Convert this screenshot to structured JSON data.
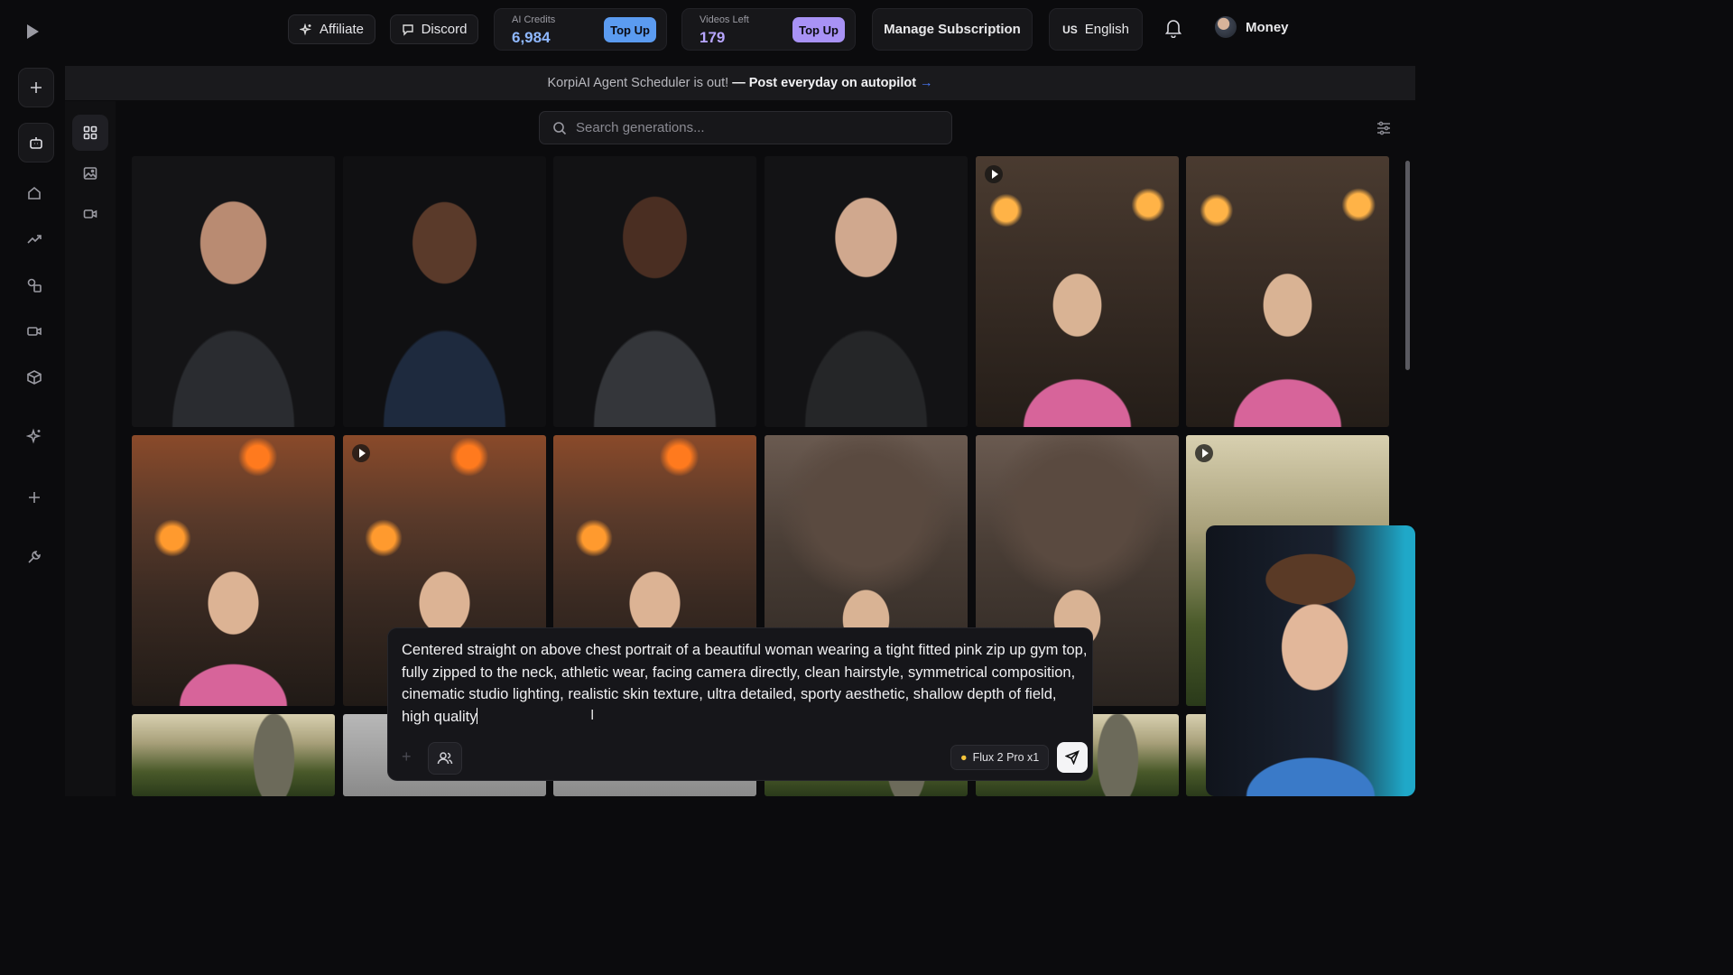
{
  "topbar": {
    "affiliate_label": "Affiliate",
    "discord_label": "Discord",
    "credits": {
      "label": "AI Credits",
      "value": "6,984",
      "button": "Top Up",
      "button_color": "#5b9bf0"
    },
    "videos": {
      "label": "Videos Left",
      "value": "179",
      "button": "Top Up",
      "button_color": "#a892f5"
    },
    "manage_label": "Manage Subscription",
    "language_flag": "US",
    "language_label": "English",
    "user_name": "Money"
  },
  "banner": {
    "text_plain": "KorpiAI Agent Scheduler is out!",
    "text_bold": "— Post everyday on autopilot",
    "arrow": "→"
  },
  "search": {
    "placeholder": "Search generations..."
  },
  "prompt": {
    "text": "Centered straight on above chest portrait of a beautiful woman wearing a tight fitted pink zip up gym top, fully zipped to the neck, athletic wear, facing camera directly, clean hairstyle, symmetrical composition, cinematic studio lighting, realistic skin texture, ultra detailed, sporty aesthetic, shallow depth of field, high quality",
    "model_label": "Flux 2 Pro x1"
  },
  "gallery": [
    {
      "name": "generation-man-gray-shirt",
      "has_play": false
    },
    {
      "name": "generation-man-navy-shirt",
      "has_play": false
    },
    {
      "name": "generation-man-dark-shirt",
      "has_play": false
    },
    {
      "name": "generation-man-black-shirt",
      "has_play": false
    },
    {
      "name": "generation-woman-castle-video",
      "has_play": true
    },
    {
      "name": "generation-woman-castle",
      "has_play": false
    },
    {
      "name": "generation-woman-battle",
      "has_play": false
    },
    {
      "name": "generation-woman-battle-video",
      "has_play": true
    },
    {
      "name": "generation-woman-battle-2",
      "has_play": false
    },
    {
      "name": "generation-woman-ruins",
      "has_play": false
    },
    {
      "name": "generation-woman-ruins-2",
      "has_play": false
    },
    {
      "name": "generation-dinosaur-video",
      "has_play": true
    }
  ],
  "colors": {
    "accent_blue": "#4a7bff",
    "brand_pink": "#d7649a"
  }
}
